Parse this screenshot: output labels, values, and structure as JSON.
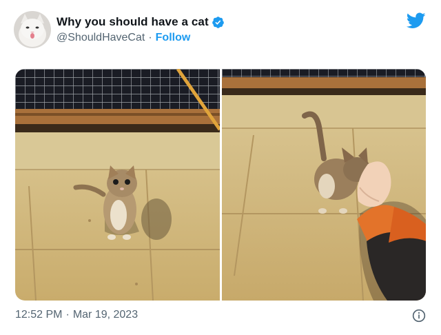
{
  "tweet": {
    "author": {
      "display_name": "Why you should have a cat",
      "handle": "@ShouldHaveCat",
      "separator": "·",
      "follow_label": "Follow",
      "verified": true,
      "avatar_icon": "white-cat-avatar"
    },
    "media": [
      {
        "icon": "photo-kitten-looking-up"
      },
      {
        "icon": "photo-kitten-rubbing-hand"
      }
    ],
    "footer": {
      "time": "12:52 PM",
      "separator": "·",
      "date": "Mar 19, 2023"
    }
  },
  "icons": {
    "brand_logo": "twitter-bird-icon",
    "verified": "verified-badge-icon",
    "info": "info-icon"
  },
  "colors": {
    "twitter_blue": "#1d9bf0",
    "text_primary": "#0f1419",
    "text_secondary": "#536471"
  }
}
